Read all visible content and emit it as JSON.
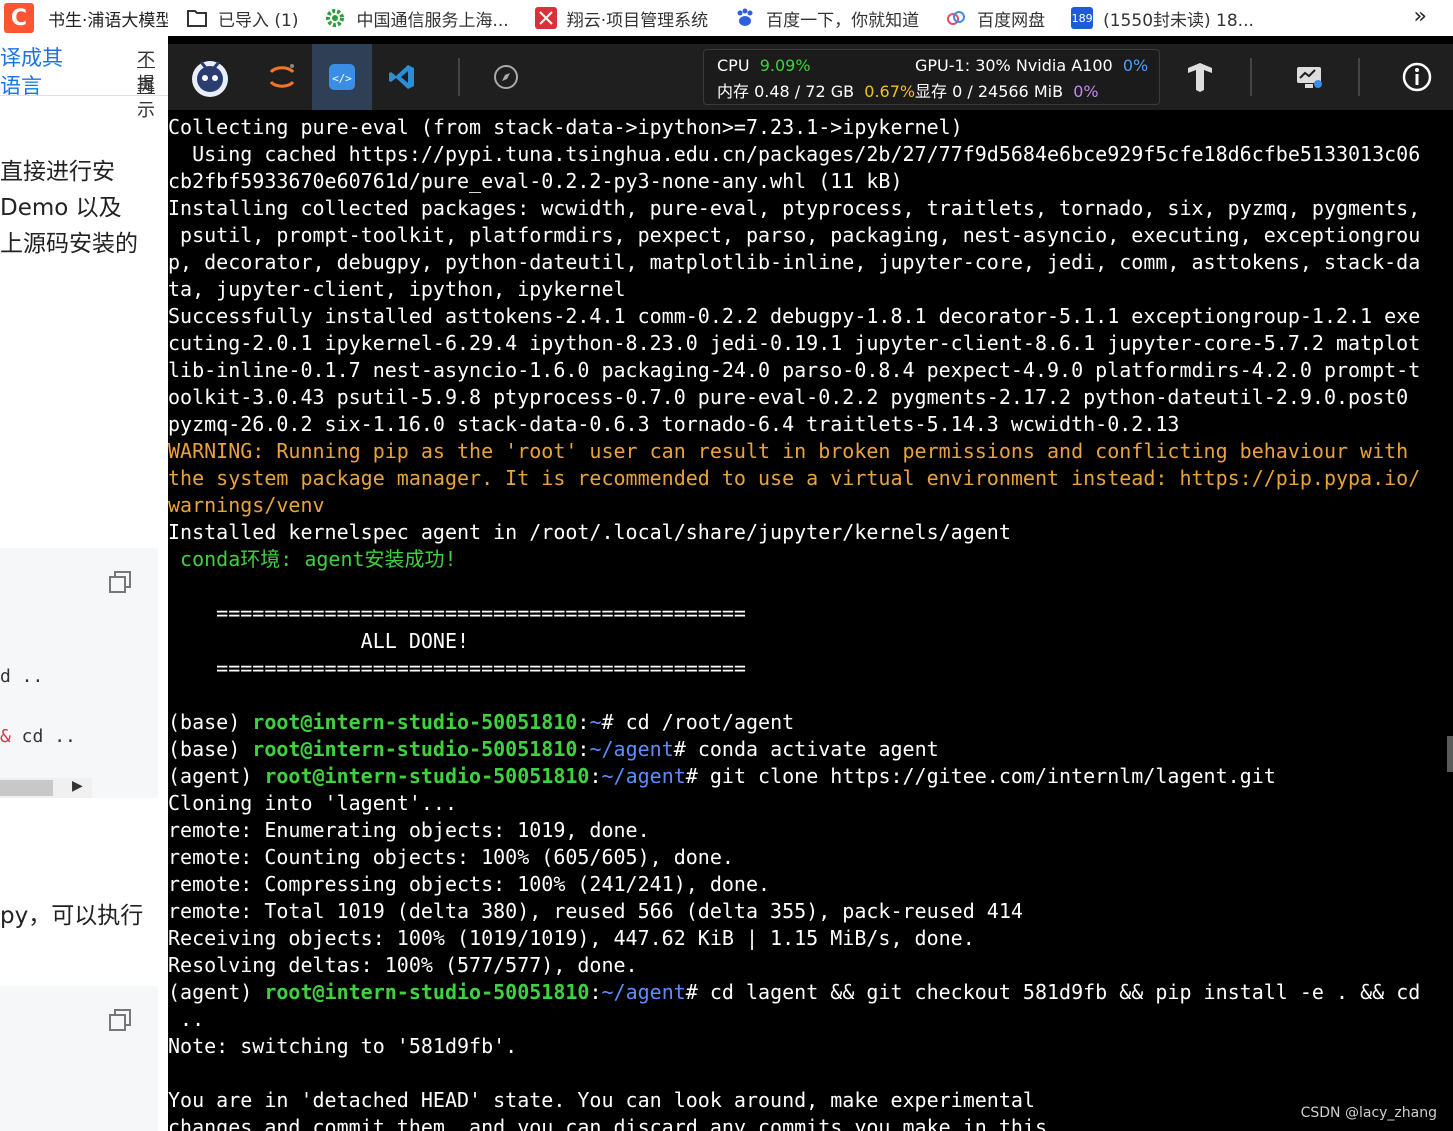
{
  "browser": {
    "tab_title": "书生·浦语大模型",
    "tab_logo": "C",
    "bookmarks": [
      {
        "icon": "folder-icon",
        "label": "已导入 (1)"
      },
      {
        "icon": "gear-icon",
        "label": "中国通信服务上海..."
      },
      {
        "icon": "app-icon",
        "label": "翔云·项目管理系统"
      },
      {
        "icon": "paw-icon",
        "label": "百度一下，你就知道"
      },
      {
        "icon": "cloud-icon",
        "label": "百度网盘"
      },
      {
        "icon": "mail-icon",
        "label": "(1550封未读) 18..."
      }
    ],
    "more": "»"
  },
  "left_panel": {
    "top_line1": "译成其",
    "top_line2": "语言",
    "top_right1": "不再",
    "top_right2": "提示",
    "para": [
      "直接进行安",
      "Demo 以及",
      "上源码安装的"
    ],
    "code1": "d ..",
    "code2_a": "&",
    "code2_b": " cd ..",
    "para2": "py，可以执行"
  },
  "toolbar": {
    "stats": {
      "cpu_label": "CPU",
      "cpu_value": "9.09%",
      "mem_label": "内存 0.48 / 72 GB",
      "mem_pct": "0.67%",
      "gpu_label": "GPU-1: 30% Nvidia A100",
      "gpu_pct": "0%",
      "vram_label": "显存 0 / 24566 MiB",
      "vram_pct": "0%"
    }
  },
  "terminal": {
    "lines": [
      "Collecting pure-eval (from stack-data->ipython>=7.23.1->ipykernel)",
      "  Using cached https://pypi.tuna.tsinghua.edu.cn/packages/2b/27/77f9d5684e6bce929f5cfe18d6cfbe5133013c06",
      "cb2fbf5933670e60761d/pure_eval-0.2.2-py3-none-any.whl (11 kB)",
      "Installing collected packages: wcwidth, pure-eval, ptyprocess, traitlets, tornado, six, pyzmq, pygments,",
      " psutil, prompt-toolkit, platformdirs, pexpect, parso, packaging, nest-asyncio, executing, exceptiongrou",
      "p, decorator, debugpy, python-dateutil, matplotlib-inline, jupyter-core, jedi, comm, asttokens, stack-da",
      "ta, jupyter-client, ipython, ipykernel",
      "Successfully installed asttokens-2.4.1 comm-0.2.2 debugpy-1.8.1 decorator-5.1.1 exceptiongroup-1.2.1 exe",
      "cuting-2.0.1 ipykernel-6.29.4 ipython-8.23.0 jedi-0.19.1 jupyter-client-8.6.1 jupyter-core-5.7.2 matplot",
      "lib-inline-0.1.7 nest-asyncio-1.6.0 packaging-24.0 parso-0.8.4 pexpect-4.9.0 platformdirs-4.2.0 prompt-t",
      "oolkit-3.0.43 psutil-5.9.8 ptyprocess-0.7.0 pure-eval-0.2.2 pygments-2.17.2 python-dateutil-2.9.0.post0",
      "pyzmq-26.0.2 six-1.16.0 stack-data-0.6.3 tornado-6.4 traitlets-5.14.3 wcwidth-0.2.13"
    ],
    "warning_lines": [
      "WARNING: Running pip as the 'root' user can result in broken permissions and conflicting behaviour with",
      "the system package manager. It is recommended to use a virtual environment instead: https://pip.pypa.io/",
      "warnings/venv"
    ],
    "kernelspec": "Installed kernelspec agent in /root/.local/share/jupyter/kernels/agent",
    "conda_success": " conda环境: agent安装成功!",
    "rule": "    ============================================",
    "all_done": "                ALL DONE!",
    "prompts": [
      {
        "env": "(base) ",
        "user": "root@intern-studio-50051810",
        "path": "~",
        "cmd": "# cd /root/agent"
      },
      {
        "env": "(base) ",
        "user": "root@intern-studio-50051810",
        "path": "~/agent",
        "cmd": "# conda activate agent"
      },
      {
        "env": "(agent) ",
        "user": "root@intern-studio-50051810",
        "path": "~/agent",
        "cmd": "# git clone https://gitee.com/internlm/lagent.git"
      }
    ],
    "clone_lines": [
      "Cloning into 'lagent'...",
      "remote: Enumerating objects: 1019, done.",
      "remote: Counting objects: 100% (605/605), done.",
      "remote: Compressing objects: 100% (241/241), done.",
      "remote: Total 1019 (delta 380), reused 566 (delta 355), pack-reused 414",
      "Receiving objects: 100% (1019/1019), 447.62 KiB | 1.15 MiB/s, done.",
      "Resolving deltas: 100% (577/577), done."
    ],
    "last_prompt": {
      "env": "(agent) ",
      "user": "root@intern-studio-50051810",
      "path": "~/agent",
      "cmd": "# cd lagent && git checkout 581d9fb && pip install -e . && cd"
    },
    "cont": " ..",
    "note": "Note: switching to '581d9fb'.",
    "detached1": "You are in 'detached HEAD' state. You can look around, make experimental",
    "detached2": "changes and commit them, and you can discard any commits you make in this"
  },
  "watermark": "CSDN @lacy_zhang"
}
